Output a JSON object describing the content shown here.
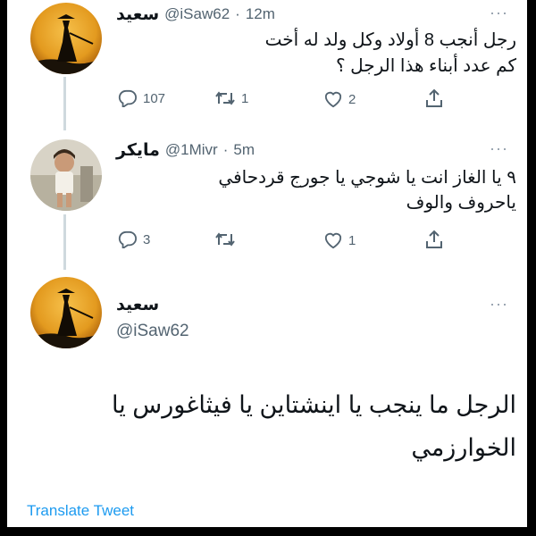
{
  "tweets": [
    {
      "name": "سعيد",
      "handle": "@iSaw62",
      "sep": "·",
      "time": "12m",
      "line1": "رجل أنجب 8 أولاد وكل ولد له أخت",
      "line2": "كم عدد أبناء هذا الرجل ؟",
      "replies": "107",
      "retweets": "1",
      "likes": "2"
    },
    {
      "name": "مايكر",
      "handle": "@1Mivr",
      "sep": "·",
      "time": "5m",
      "line1": "٩ يا الغاز انت يا شوجي يا جورج قردحافي",
      "line2": "ياحروف والوف",
      "replies": "3",
      "retweets": "",
      "likes": "1"
    }
  ],
  "main_tweet": {
    "name": "سعيد",
    "handle": "@iSaw62",
    "line1": "الرجل ما ينجب يا اينشتاين يا فيثاغورس يا",
    "line2": "الخوارزمي",
    "translate": "Translate Tweet"
  },
  "more_glyph": "···",
  "colors": {
    "accent": "#1d9bf0",
    "text": "#0f1419",
    "secondary": "#536471",
    "line": "#cfd9de"
  },
  "icons": [
    "reply-icon",
    "retweet-icon",
    "like-icon",
    "share-icon",
    "more-icon"
  ]
}
